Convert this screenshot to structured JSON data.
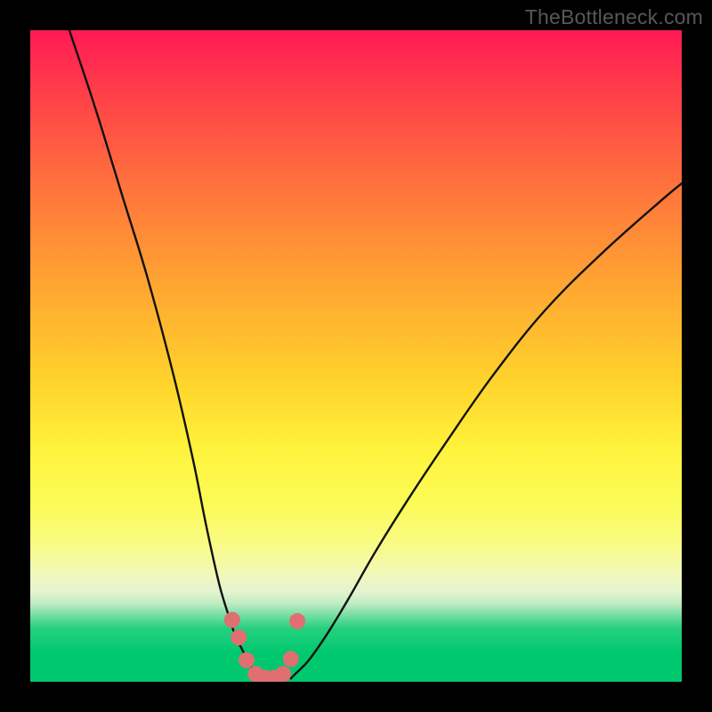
{
  "watermark": "TheBottleneck.com",
  "colors": {
    "frame": "#000000",
    "curve": "#111111",
    "dots": "#e06f72",
    "green": "#00c86f",
    "topRed": "#ff1a55"
  },
  "chart_data": {
    "type": "line",
    "title": "",
    "xlabel": "",
    "ylabel": "",
    "xlim": [
      0,
      100
    ],
    "ylim": [
      0,
      100
    ],
    "series": [
      {
        "name": "left-curve",
        "x": [
          6,
          10,
          14,
          18,
          22,
          25,
          27,
          29,
          30.5,
          31.5,
          32.5,
          33.5,
          34.5,
          35.5
        ],
        "values": [
          100,
          88,
          75,
          62,
          47,
          34,
          24,
          15,
          10,
          7,
          5,
          3,
          1.5,
          0.5
        ]
      },
      {
        "name": "right-curve",
        "x": [
          40,
          41,
          42.5,
          44,
          46,
          49,
          53,
          58,
          64,
          71,
          79,
          88,
          97,
          100
        ],
        "values": [
          0.5,
          1.5,
          3,
          5,
          8,
          13,
          20,
          28,
          37,
          47,
          57,
          66,
          74,
          76.5
        ]
      }
    ],
    "dots": {
      "name": "markers",
      "x": [
        31,
        32,
        33.2,
        34.6,
        36,
        37.4,
        38.8,
        40,
        41
      ],
      "values": [
        9.5,
        6.8,
        3.3,
        1.2,
        0.6,
        0.6,
        1.2,
        3.5,
        9.3
      ],
      "radius_px": 9
    }
  }
}
